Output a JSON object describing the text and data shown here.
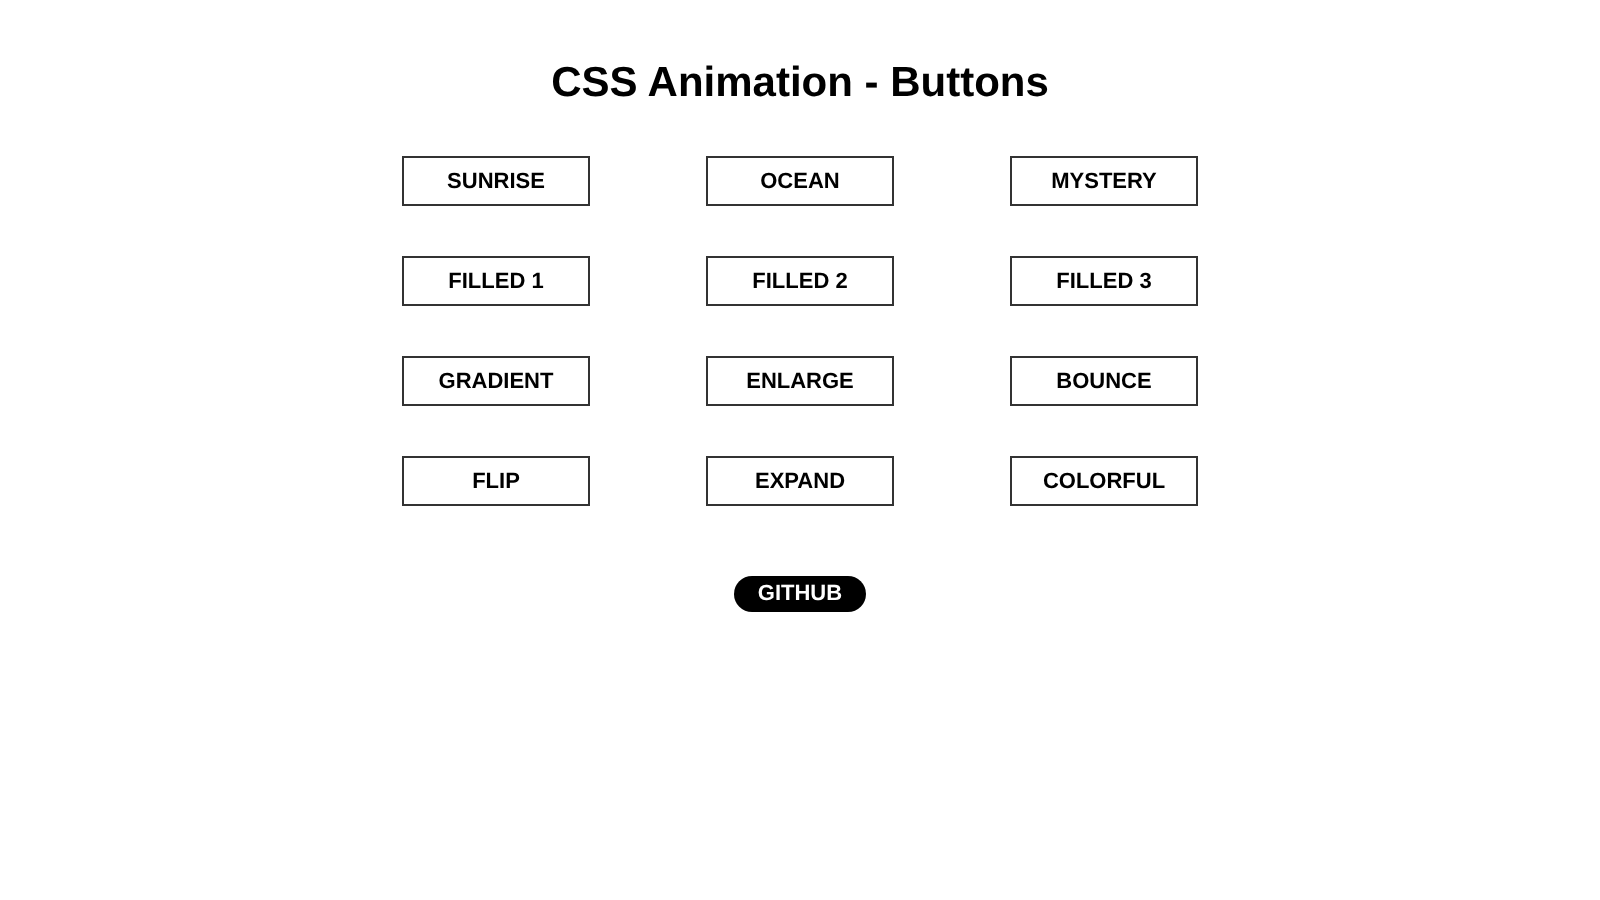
{
  "title": "CSS Animation - Buttons",
  "buttons": [
    {
      "label": "SUNRISE"
    },
    {
      "label": "OCEAN"
    },
    {
      "label": "MYSTERY"
    },
    {
      "label": "FILLED 1"
    },
    {
      "label": "FILLED 2"
    },
    {
      "label": "FILLED 3"
    },
    {
      "label": "GRADIENT"
    },
    {
      "label": "ENLARGE"
    },
    {
      "label": "BOUNCE"
    },
    {
      "label": "FLIP"
    },
    {
      "label": "EXPAND"
    },
    {
      "label": "COLORFUL"
    }
  ],
  "link": {
    "label": "GITHUB"
  }
}
